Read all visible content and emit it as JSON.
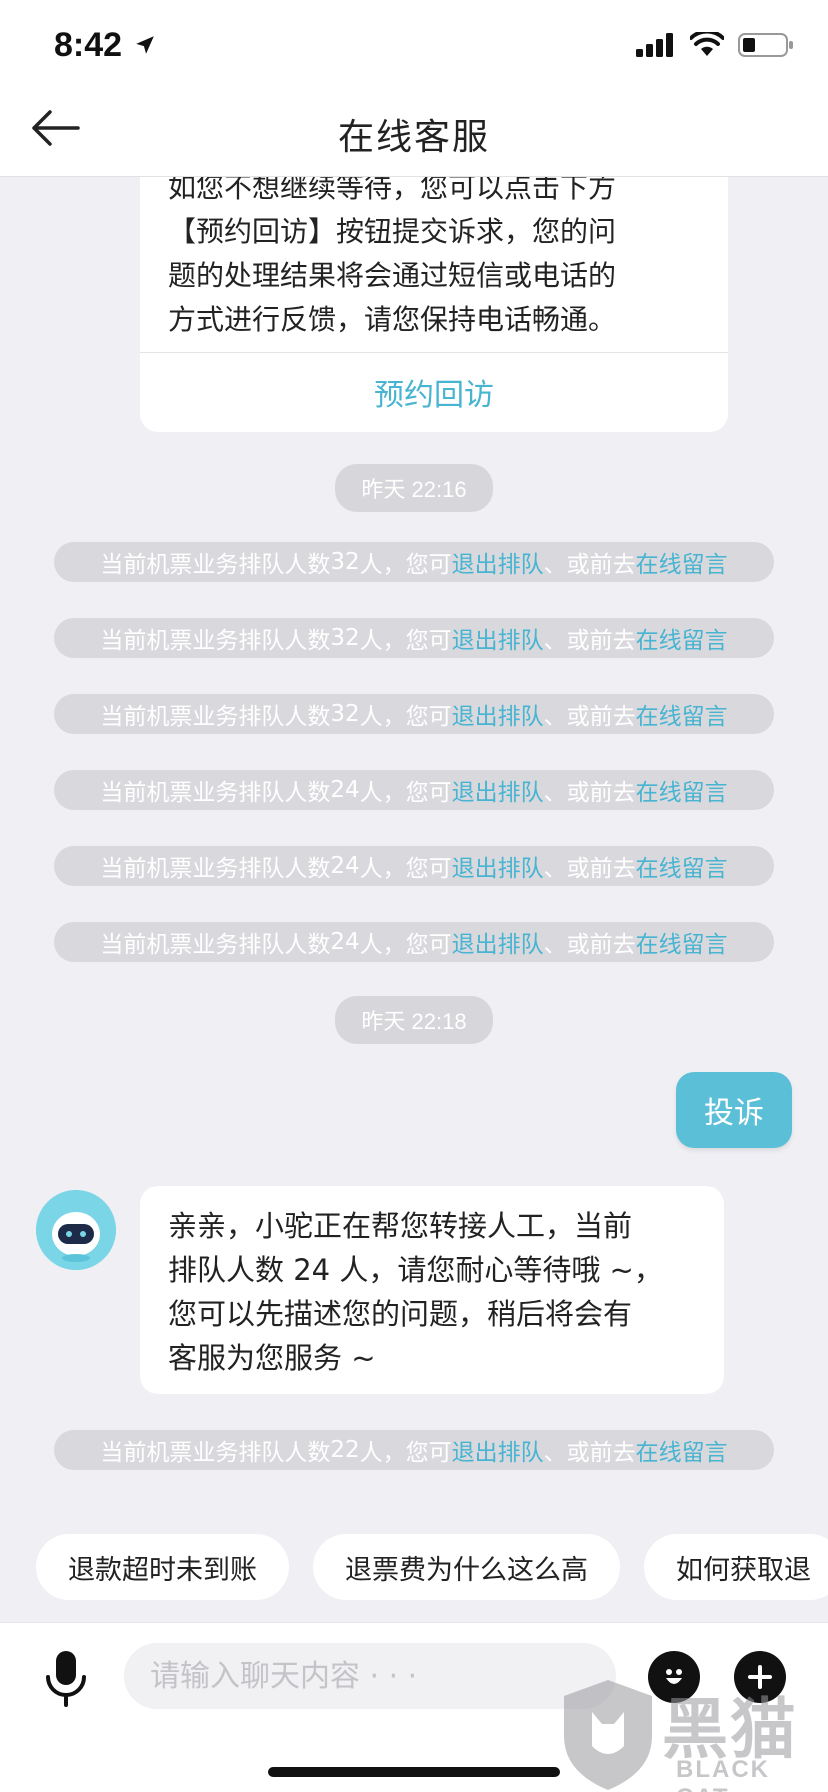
{
  "status_bar": {
    "time": "8:42"
  },
  "nav": {
    "title": "在线客服"
  },
  "card": {
    "text": "如您不想继续等待，您可以点击下方\n【预约回访】按钮提交诉求，您的问\n题的处理结果将会通过短信或电话的\n方式进行反馈，请您保持电话畅通。",
    "action": "预约回访"
  },
  "timestamps": [
    "昨天 22:16",
    "昨天 22:18"
  ],
  "sys_prefix": "当前机票业务排队人数",
  "sys_suffix": "人，您可",
  "sys_link1": "退出排队",
  "sys_mid": "、或前去",
  "sys_link2": "在线留言",
  "queue_msgs": [
    {
      "count": "32"
    },
    {
      "count": "32"
    },
    {
      "count": "32"
    },
    {
      "count": "24"
    },
    {
      "count": "24"
    },
    {
      "count": "24"
    },
    {
      "count": "22"
    }
  ],
  "user_message": "投诉",
  "bot_message": "亲亲，小驼正在帮您转接人工，当前\n排队人数 24 人，请您耐心等待哦 ~，\n您可以先描述您的问题，稍后将会有\n客服为您服务 ~",
  "quick_replies": [
    "退款超时未到账",
    "退票费为什么这么高",
    "如何获取退"
  ],
  "input": {
    "placeholder": "请输入聊天内容 · · ·"
  },
  "watermark": {
    "cn": "黑猫",
    "en": "BLACK CAT"
  },
  "colors": {
    "accent": "#47b4d1",
    "user_bubble": "#5bbfd8",
    "background": "#efeff4"
  }
}
